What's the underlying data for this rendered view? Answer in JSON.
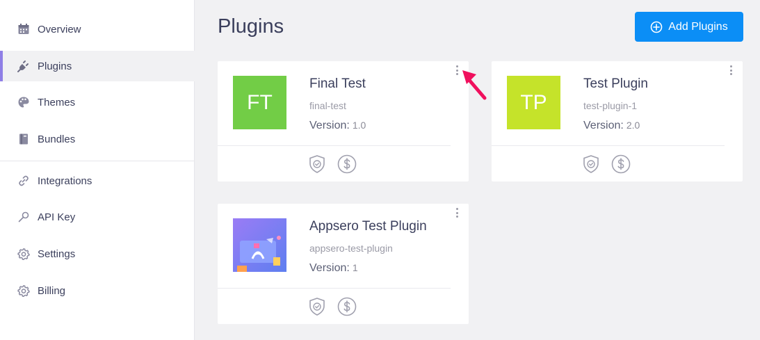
{
  "sidebar": {
    "items": [
      {
        "label": "Overview",
        "icon": "calendar-icon"
      },
      {
        "label": "Plugins",
        "icon": "plug-icon",
        "active": true
      },
      {
        "label": "Themes",
        "icon": "palette-icon"
      },
      {
        "label": "Bundles",
        "icon": "book-icon"
      },
      {
        "label": "Integrations",
        "icon": "link-icon"
      },
      {
        "label": "API Key",
        "icon": "key-icon"
      },
      {
        "label": "Settings",
        "icon": "gear-icon"
      },
      {
        "label": "Billing",
        "icon": "gear-icon"
      }
    ]
  },
  "header": {
    "title": "Plugins",
    "add_button_label": "Add Plugins"
  },
  "plugins": [
    {
      "initials": "FT",
      "name": "Final Test",
      "slug": "final-test",
      "version_label": "Version:",
      "version": "1.0",
      "color": "#72cd46"
    },
    {
      "initials": "TP",
      "name": "Test Plugin",
      "slug": "test-plugin-1",
      "version_label": "Version:",
      "version": "2.0",
      "color": "#c5e32a"
    },
    {
      "initials": "",
      "name": "Appsero Test Plugin",
      "slug": "appsero-test-plugin",
      "version_label": "Version:",
      "version": "1",
      "color": "#7d6df0"
    }
  ],
  "colors": {
    "accent": "#0b8ef6",
    "active_bar": "#8f7fe6",
    "annotation_arrow": "#f0105d"
  }
}
